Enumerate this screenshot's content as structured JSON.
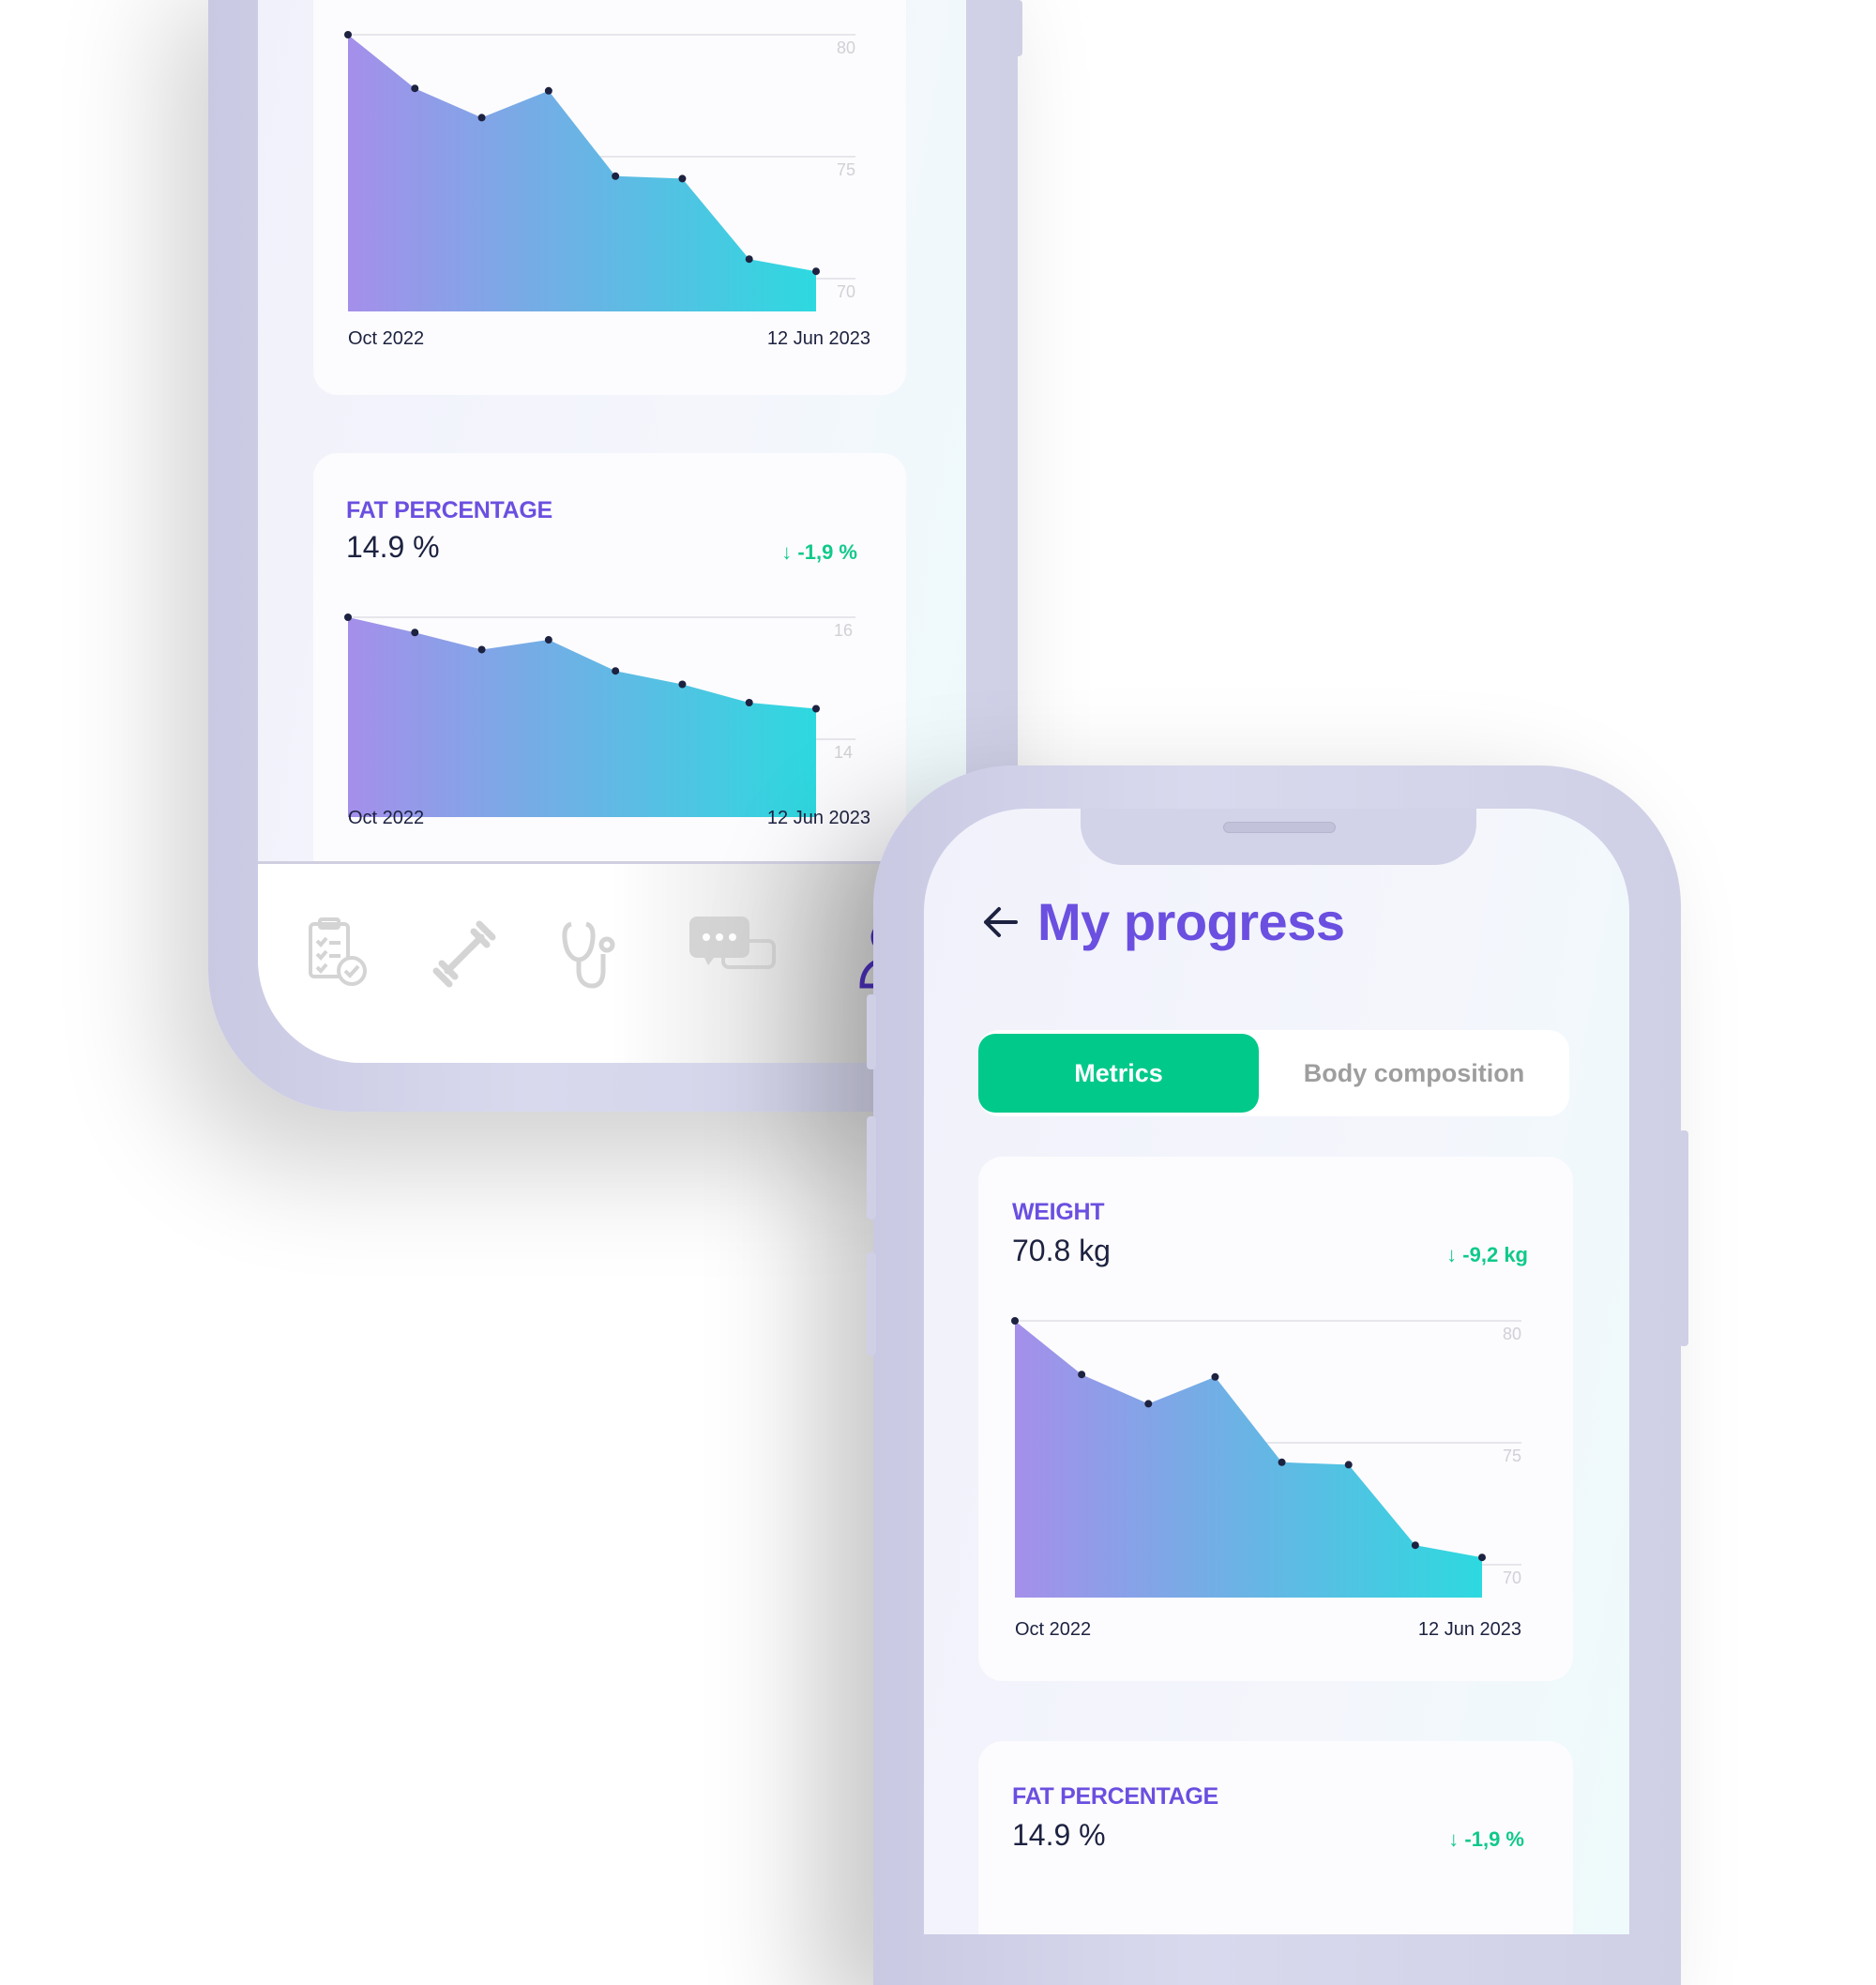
{
  "back_phone": {
    "weight_chart": {
      "type": "area",
      "ytick_labels": [
        "80",
        "75",
        "70"
      ],
      "x_start_label": "Oct 2022",
      "x_end_label": "12 Jun 2023",
      "values": [
        80,
        77.8,
        76.6,
        77.7,
        74.2,
        74.1,
        70.8,
        70.3
      ],
      "yticks": [
        80,
        75,
        70
      ]
    },
    "fat_card": {
      "label": "FAT PERCENTAGE",
      "value": "14.9 %",
      "delta": "-1,9 %",
      "chart": {
        "type": "area",
        "ytick_labels": [
          "16",
          "14"
        ],
        "x_start_label": "Oct 2022",
        "x_end_label": "12 Jun 2023",
        "values": [
          16.0,
          15.75,
          15.47,
          15.63,
          15.12,
          14.9,
          14.6,
          14.5
        ],
        "yticks": [
          16,
          14
        ]
      }
    },
    "nav": [
      {
        "icon": "clipboard-check-icon"
      },
      {
        "icon": "dumbbell-icon"
      },
      {
        "icon": "stethoscope-icon"
      },
      {
        "icon": "chat-bubbles-icon"
      },
      {
        "icon": "profile-icon",
        "active": true
      }
    ]
  },
  "front_phone": {
    "title": "My progress",
    "back_icon": "arrow-left-icon",
    "tabs": [
      {
        "label": "Metrics",
        "active": true
      },
      {
        "label": "Body composition",
        "active": false
      }
    ],
    "weight_card": {
      "label": "WEIGHT",
      "value": "70.8 kg",
      "delta": "-9,2 kg",
      "chart": {
        "type": "area",
        "ytick_labels": [
          "80",
          "75",
          "70"
        ],
        "x_start_label": "Oct 2022",
        "x_end_label": "12 Jun 2023",
        "values": [
          80,
          77.8,
          76.6,
          77.7,
          74.2,
          74.1,
          70.8,
          70.3
        ],
        "yticks": [
          80,
          75,
          70
        ]
      }
    },
    "fat_card": {
      "label": "FAT PERCENTAGE",
      "value": "14.9 %",
      "delta": "-1,9 %"
    }
  },
  "colors": {
    "accent": "#6b4fe0",
    "positive": "#10c98a",
    "tab_active": "#00c98a",
    "gradient_start": "#a58fea",
    "gradient_end": "#2dd9e0",
    "icon_inactive": "#d4d4d4"
  }
}
